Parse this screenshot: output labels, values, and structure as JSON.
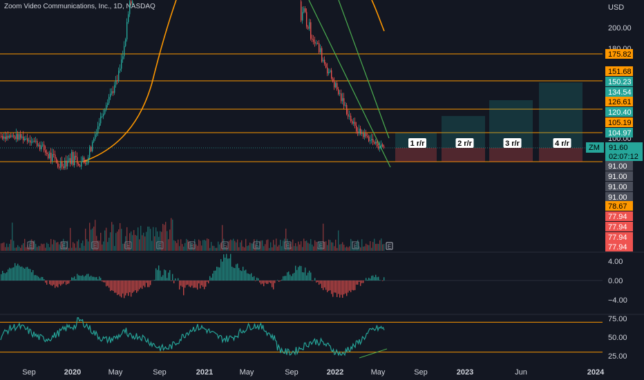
{
  "title": "Zoom Video Communications, Inc., 1D, NASDAQ",
  "currency": "USD",
  "chart_data": [
    {
      "type": "candlestick",
      "panel": "price",
      "symbol": "ZM",
      "last_price": "91.60",
      "countdown": "02:07:12",
      "y_ticks": [
        "200.00",
        "180.00",
        "100.00"
      ],
      "ylim": [
        70,
        215
      ],
      "x_ticks": [
        {
          "label": "Sep",
          "bold": false
        },
        {
          "label": "2020",
          "bold": true
        },
        {
          "label": "May",
          "bold": false
        },
        {
          "label": "Sep",
          "bold": false
        },
        {
          "label": "2021",
          "bold": true
        },
        {
          "label": "May",
          "bold": false
        },
        {
          "label": "Sep",
          "bold": false
        },
        {
          "label": "2022",
          "bold": true
        },
        {
          "label": "May",
          "bold": false
        },
        {
          "label": "Sep",
          "bold": false
        },
        {
          "label": "2023",
          "bold": true
        },
        {
          "label": "Jun",
          "bold": false
        },
        {
          "label": "2024",
          "bold": true
        }
      ],
      "close_path": [
        [
          0.0,
          102
        ],
        [
          0.03,
          101
        ],
        [
          0.05,
          98
        ],
        [
          0.07,
          90
        ],
        [
          0.09,
          85
        ],
        [
          0.11,
          88
        ],
        [
          0.13,
          86
        ],
        [
          0.14,
          92
        ],
        [
          0.15,
          110
        ],
        [
          0.165,
          135
        ],
        [
          0.18,
          150
        ],
        [
          0.19,
          175
        ],
        [
          0.2,
          215
        ],
        [
          0.47,
          210
        ],
        [
          0.48,
          195
        ],
        [
          0.5,
          170
        ],
        [
          0.52,
          145
        ],
        [
          0.54,
          120
        ],
        [
          0.55,
          108
        ],
        [
          0.56,
          104
        ],
        [
          0.57,
          100
        ],
        [
          0.58,
          95
        ],
        [
          0.595,
          91.6
        ]
      ],
      "horizontal_levels": [
        "175.82",
        "151.68",
        "126.61",
        "105.19",
        "91.00"
      ],
      "price_badges": [
        {
          "value": "175.82",
          "color": "#ff9800",
          "text_color": "#000000"
        },
        {
          "value": "151.68",
          "color": "#ff9800",
          "text_color": "#000000"
        },
        {
          "value": "150.23",
          "color": "#26a69a",
          "text_color": "#ffffff"
        },
        {
          "value": "134.54",
          "color": "#26a69a",
          "text_color": "#ffffff"
        },
        {
          "value": "126.61",
          "color": "#ff9800",
          "text_color": "#000000"
        },
        {
          "value": "120.40",
          "color": "#26a69a",
          "text_color": "#ffffff"
        },
        {
          "value": "105.19",
          "color": "#ff9800",
          "text_color": "#000000"
        },
        {
          "value": "104.97",
          "color": "#26a69a",
          "text_color": "#ffffff"
        },
        {
          "value": "91.00",
          "color": "#4a4e5a",
          "text_color": "#ffffff"
        },
        {
          "value": "91.00",
          "color": "#4a4e5a",
          "text_color": "#ffffff"
        },
        {
          "value": "91.00",
          "color": "#4a4e5a",
          "text_color": "#ffffff"
        },
        {
          "value": "91.00",
          "color": "#4a4e5a",
          "text_color": "#ffffff"
        },
        {
          "value": "78.67",
          "color": "#ff9800",
          "text_color": "#000000"
        },
        {
          "value": "77.94",
          "color": "#ef5350",
          "text_color": "#ffffff"
        },
        {
          "value": "77.94",
          "color": "#ef5350",
          "text_color": "#ffffff"
        },
        {
          "value": "77.94",
          "color": "#ef5350",
          "text_color": "#ffffff"
        },
        {
          "value": "77.94",
          "color": "#ef5350",
          "text_color": "#ffffff"
        }
      ],
      "risk_reward_boxes": [
        {
          "label": "1 r/r",
          "entry": 91.6,
          "target": 104.97,
          "stop": 77.94
        },
        {
          "label": "2 r/r",
          "entry": 91.6,
          "target": 120.4,
          "stop": 77.94
        },
        {
          "label": "3 r/r",
          "entry": 91.6,
          "target": 134.54,
          "stop": 77.94
        },
        {
          "label": "4 r/r",
          "entry": 91.6,
          "target": 150.23,
          "stop": 77.94
        }
      ],
      "earnings_marker": "E"
    },
    {
      "type": "histogram",
      "panel": "oscillator",
      "y_ticks": [
        "4.00",
        "0.00",
        "−4.00"
      ],
      "ylim": [
        -7,
        6
      ]
    },
    {
      "type": "line",
      "panel": "rsi",
      "y_ticks": [
        "75.00",
        "50.00",
        "25.00"
      ],
      "levels": [
        70,
        30
      ],
      "ylim": [
        20,
        80
      ]
    }
  ],
  "colors": {
    "background": "#131722",
    "up": "#26a69a",
    "down": "#ef5350",
    "level": "#ff9800",
    "channel": "#4caf50",
    "rsi": "#26a69a",
    "axis_text": "#d1d4dc"
  }
}
